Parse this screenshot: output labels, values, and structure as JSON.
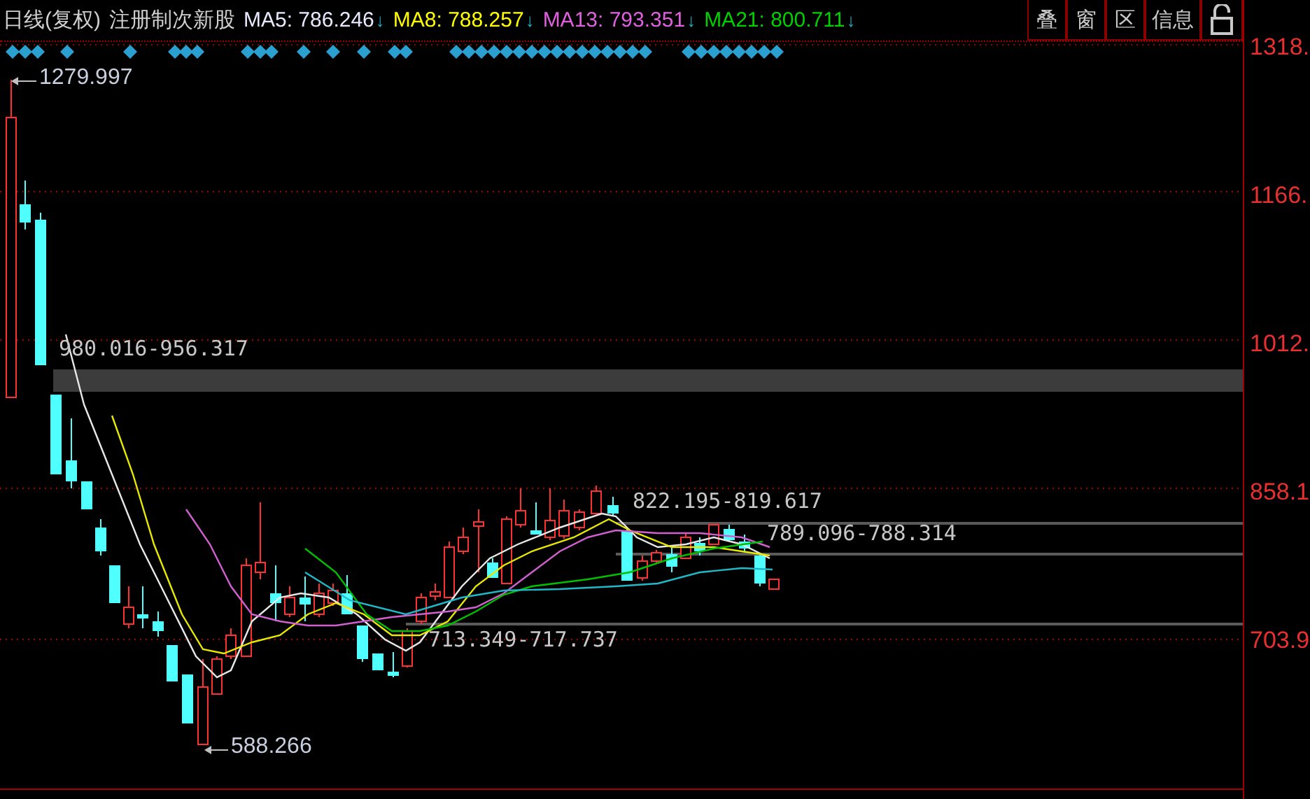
{
  "header": {
    "title": "日线(复权)",
    "subtitle": "注册制次新股",
    "ma": [
      {
        "label": "MA5: 786.246",
        "arrow": "↓",
        "color": "#e8e8ff"
      },
      {
        "label": "MA8: 788.257",
        "arrow": "↓",
        "color": "#ffff00"
      },
      {
        "label": "MA13: 793.351",
        "arrow": "↓",
        "color": "#e060e0"
      },
      {
        "label": "MA21: 800.711",
        "arrow": "↓",
        "color": "#00d000"
      }
    ],
    "buttons": [
      "叠",
      "窗",
      "区",
      "信息"
    ]
  },
  "y_axis_labels": [
    "1318.",
    "1166.",
    "1012.",
    "858.1",
    "703.9"
  ],
  "annotations": [
    {
      "kind": "extreme",
      "text": "1279.997"
    },
    {
      "kind": "zone",
      "text": "980.016-956.317"
    },
    {
      "kind": "zone",
      "text": "822.195-819.617"
    },
    {
      "kind": "zone",
      "text": "789.096-788.314"
    },
    {
      "kind": "zone",
      "text": "713.349-717.737"
    },
    {
      "kind": "extreme",
      "text": "588.266"
    }
  ]
}
